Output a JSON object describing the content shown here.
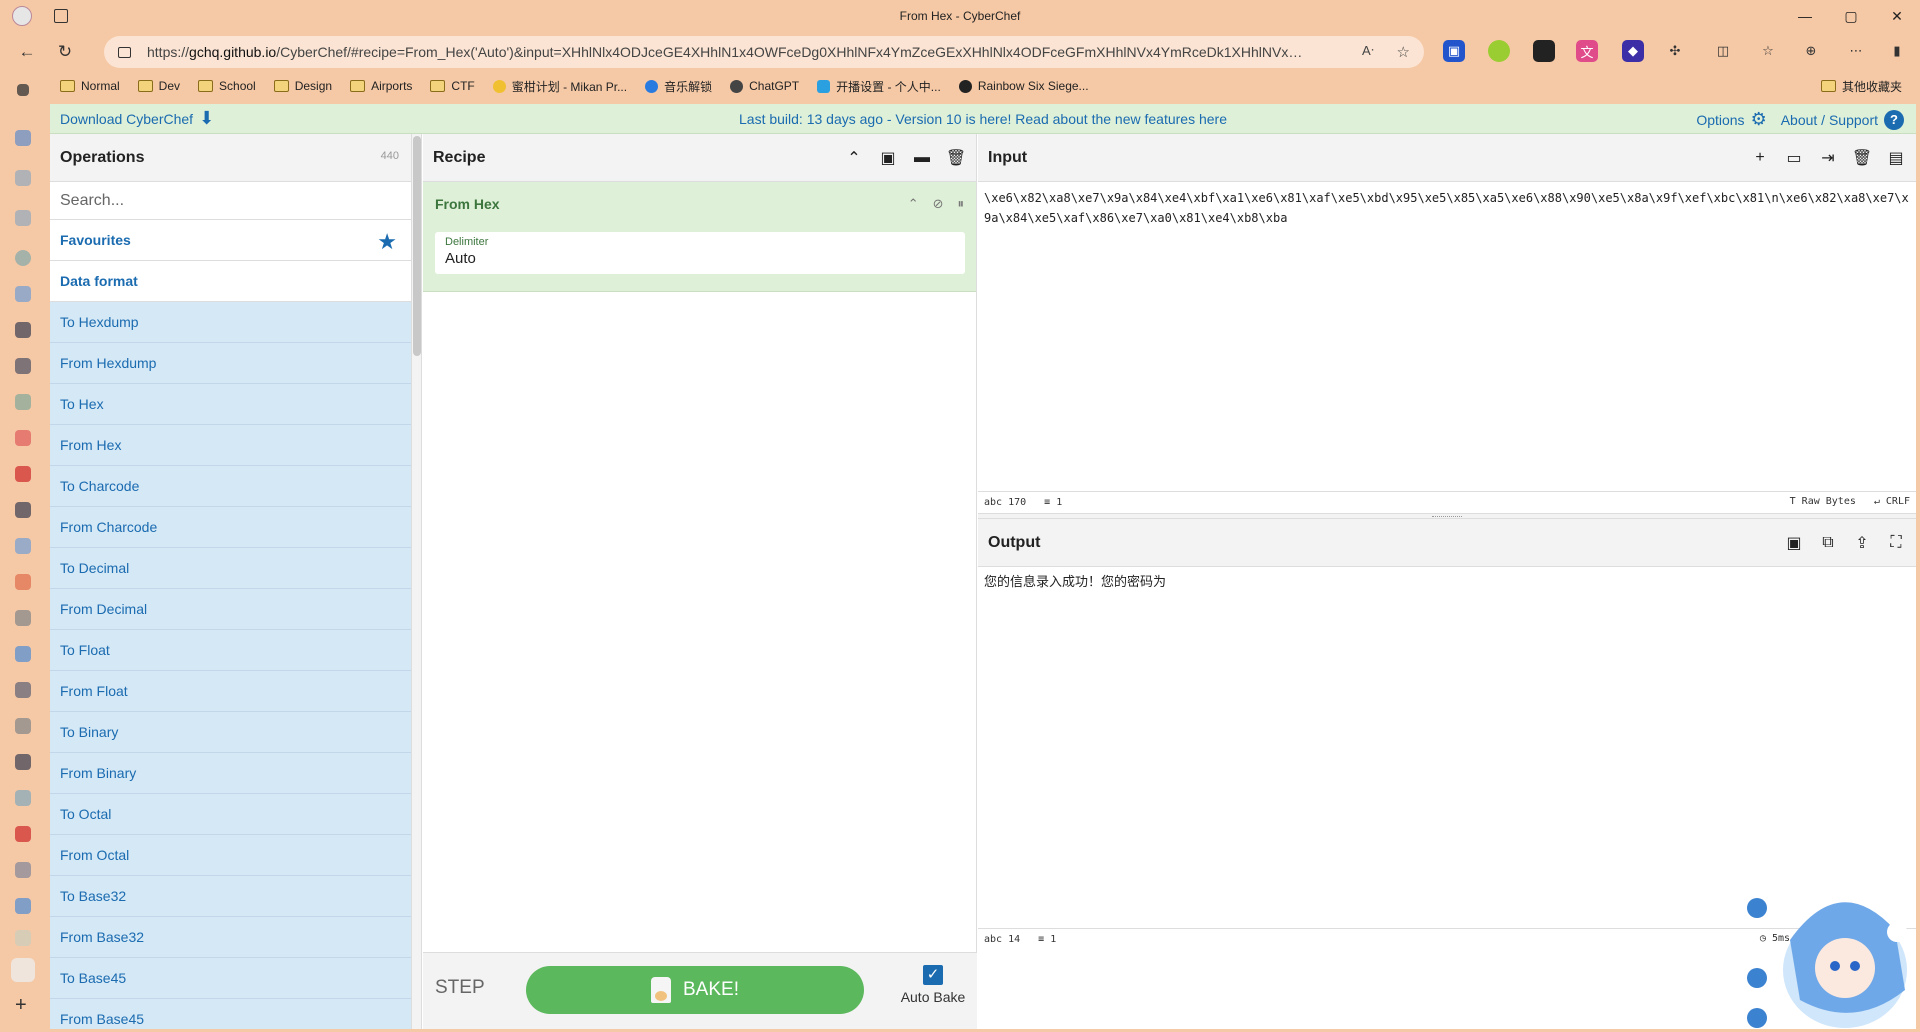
{
  "window": {
    "title": "From Hex - CyberChef",
    "controls": [
      "—",
      "▢",
      "✕"
    ]
  },
  "address": {
    "url_prefix": "https://",
    "url_host": "gchq.github.io",
    "url_path": "/CyberChef/#recipe=From_Hex('Auto')&input=XHhlNlx4ODJceGE4XHhlN1x4OWFceDg0XHhlNFx4YmZceGExXHhlNlx4ODFceGFmXHhlNVx4YmRceDk1XHhlNVx4ODVceGE..."
  },
  "bookmarks": [
    {
      "label": "Normal",
      "type": "folder"
    },
    {
      "label": "Dev",
      "type": "folder"
    },
    {
      "label": "School",
      "type": "folder"
    },
    {
      "label": "Design",
      "type": "folder"
    },
    {
      "label": "Airports",
      "type": "folder"
    },
    {
      "label": "CTF",
      "type": "folder"
    },
    {
      "label": "蜜柑计划 - Mikan Pr...",
      "type": "site",
      "color": "#f0c030"
    },
    {
      "label": "音乐解锁",
      "type": "site",
      "color": "#2a7be0"
    },
    {
      "label": "ChatGPT",
      "type": "site",
      "color": "#444444"
    },
    {
      "label": "开播设置 - 个人中...",
      "type": "site",
      "color": "#2aa0e0"
    },
    {
      "label": "Rainbow Six Siege...",
      "type": "site",
      "color": "#222222"
    }
  ],
  "bookmarks_right": "其他收藏夹",
  "banner": {
    "download": "Download CyberChef",
    "message": "Last build: 13 days ago - Version 10 is here! Read about the new features here",
    "options": "Options",
    "about": "About / Support"
  },
  "operations": {
    "title": "Operations",
    "count": "440",
    "search_placeholder": "Search...",
    "favourites": "Favourites",
    "category": "Data format",
    "items": [
      "To Hexdump",
      "From Hexdump",
      "To Hex",
      "From Hex",
      "To Charcode",
      "From Charcode",
      "To Decimal",
      "From Decimal",
      "To Float",
      "From Float",
      "To Binary",
      "From Binary",
      "To Octal",
      "From Octal",
      "To Base32",
      "From Base32",
      "To Base45",
      "From Base45"
    ]
  },
  "recipe": {
    "title": "Recipe",
    "operation": "From Hex",
    "arg_label": "Delimiter",
    "arg_value": "Auto",
    "step": "STEP",
    "bake": "BAKE!",
    "auto_bake": "Auto Bake"
  },
  "input": {
    "title": "Input",
    "text": "\\xe6\\x82\\xa8\\xe7\\x9a\\x84\\xe4\\xbf\\xa1\\xe6\\x81\\xaf\\xe5\\xbd\\x95\\xe5\\x85\\xa5\\xe6\\x88\\x90\\xe5\\x8a\\x9f\\xef\\xbc\\x81\\n\\xe6\\x82\\xa8\\xe7\\x9a\\x84\\xe5\\xaf\\x86\\xe7\\xa0\\x81\\xe4\\xb8\\xba",
    "chars": "170",
    "lines": "1",
    "encoding": "Raw Bytes",
    "eol": "CRLF"
  },
  "output": {
    "title": "Output",
    "text": "您的信息录入成功！您的密码为",
    "chars": "14",
    "lines": "1",
    "time": "5ms"
  }
}
